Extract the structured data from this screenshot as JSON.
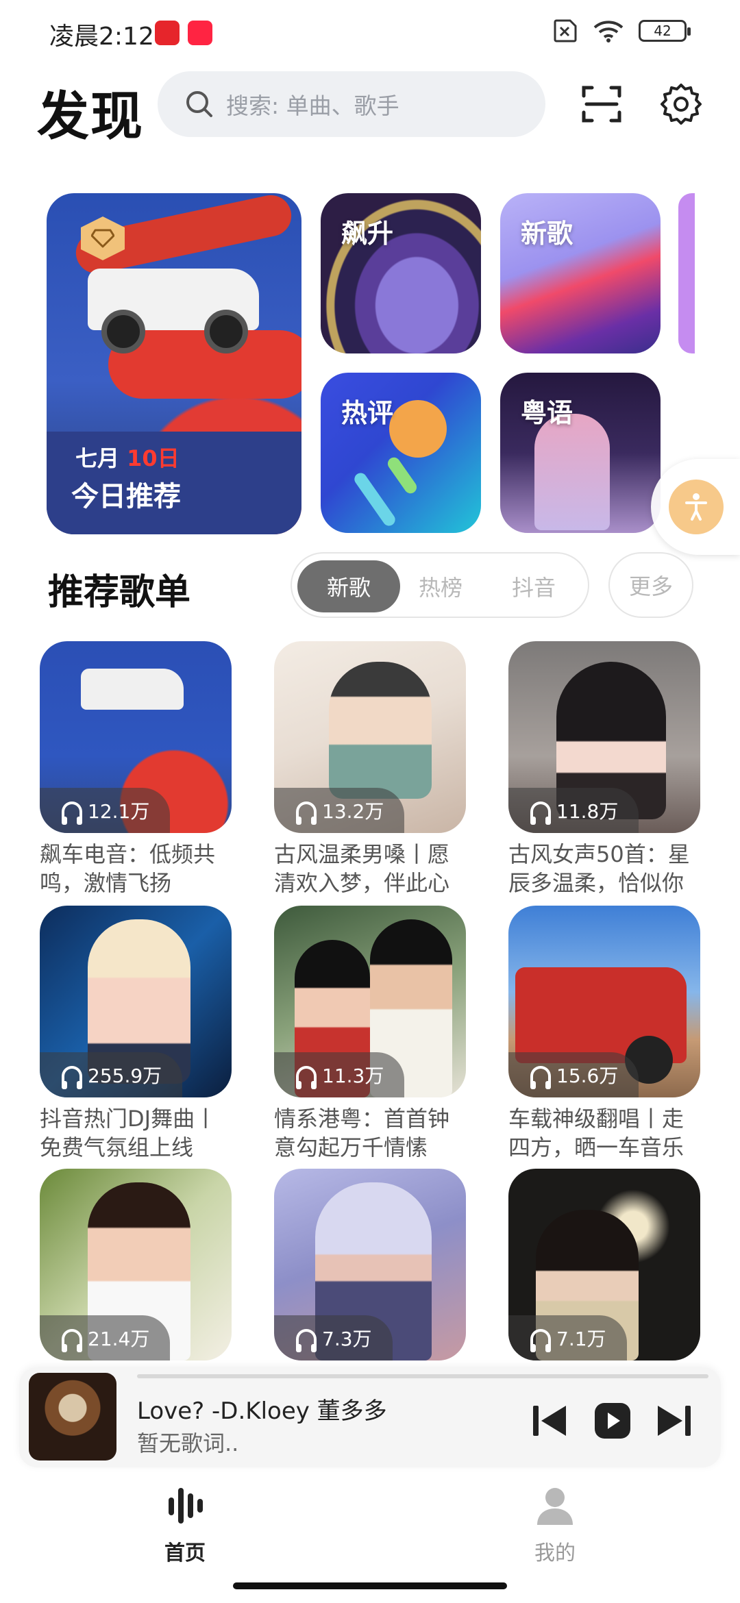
{
  "status_bar": {
    "time": "凌晨2:12",
    "battery": "42"
  },
  "header": {
    "title": "发现",
    "search_placeholder": "搜索: 单曲、歌手"
  },
  "tiles": {
    "daily": {
      "month": "七月",
      "day": "10日",
      "title": "今日推荐"
    },
    "soar": "飙升",
    "new_song": "新歌",
    "hot_comment": "热评",
    "cantonese": "粤语"
  },
  "playlist_section": {
    "title": "推荐歌单",
    "tabs": [
      "新歌",
      "热榜",
      "抖音"
    ],
    "more": "更多",
    "items": [
      {
        "plays": "12.1万",
        "title": "飙车电音：低频共鸣，激情飞扬"
      },
      {
        "plays": "13.2万",
        "title": "古风温柔男嗓丨愿清欢入梦，伴此心"
      },
      {
        "plays": "11.8万",
        "title": "古风女声50首：星辰多温柔，恰似你"
      },
      {
        "plays": "255.9万",
        "title": "抖音热门DJ舞曲丨免费气氛组上线"
      },
      {
        "plays": "11.3万",
        "title": "情系港粤：首首钟意勾起万千情愫"
      },
      {
        "plays": "15.6万",
        "title": "车载神级翻唱丨走四方，晒一车音乐"
      },
      {
        "plays": "21.4万",
        "title": ""
      },
      {
        "plays": "7.3万",
        "title": ""
      },
      {
        "plays": "7.1万",
        "title": ""
      }
    ]
  },
  "player": {
    "title": "Love?  -D.Kloey 董多多",
    "lyric": "暂无歌词.."
  },
  "bottom_nav": {
    "home": "首页",
    "mine": "我的"
  },
  "colors": {
    "accent": "#6e6e6e",
    "active_nav": "#222222",
    "inactive_nav": "#999999"
  }
}
